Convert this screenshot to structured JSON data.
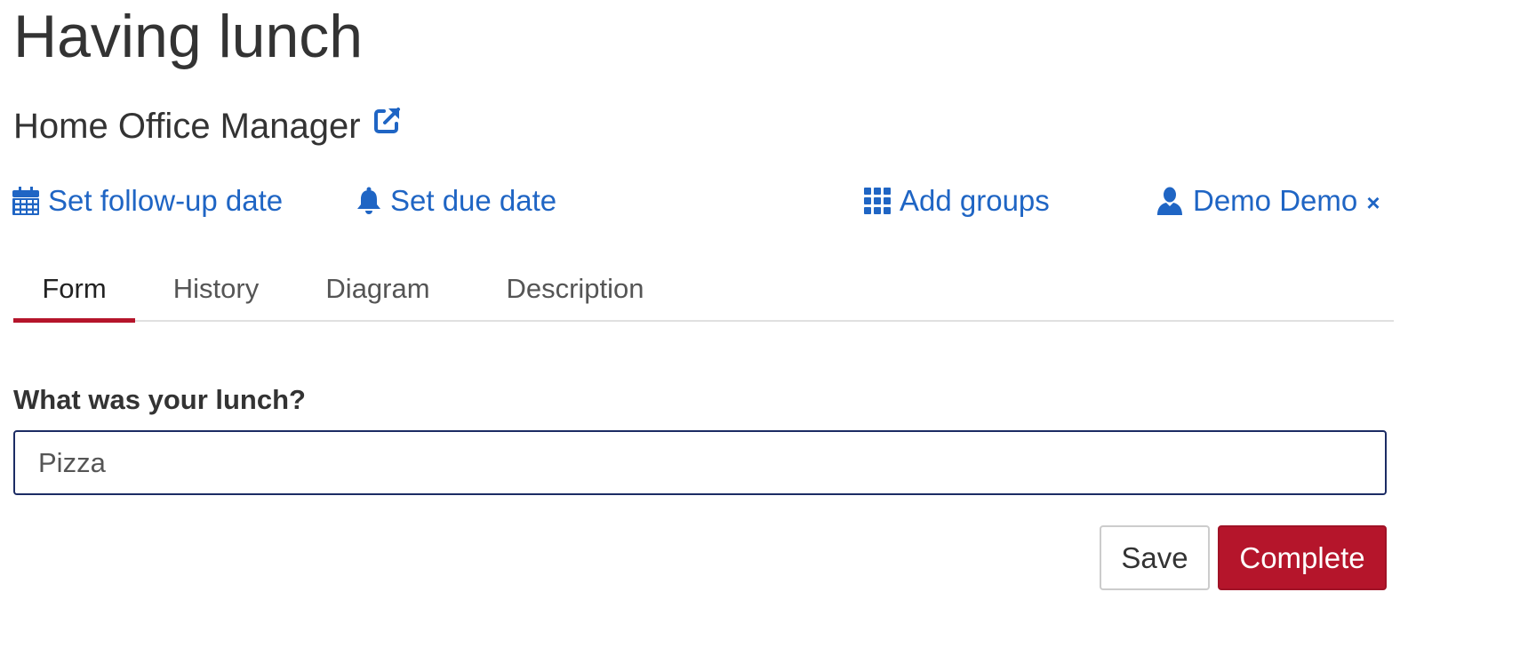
{
  "task": {
    "title": "Having lunch",
    "process_name": "Home Office Manager"
  },
  "actions": {
    "follow_up": "Set follow-up date",
    "due_date": "Set due date",
    "groups": "Add groups",
    "assignee": "Demo Demo",
    "remove_assignee": "×"
  },
  "tabs": [
    {
      "label": "Form",
      "active": true
    },
    {
      "label": "History",
      "active": false
    },
    {
      "label": "Diagram",
      "active": false
    },
    {
      "label": "Description",
      "active": false
    }
  ],
  "form": {
    "field_label": "What was your lunch?",
    "field_value": "Pizza"
  },
  "buttons": {
    "save": "Save",
    "complete": "Complete"
  },
  "colors": {
    "link": "#1f65c4",
    "accent": "#b5152b",
    "input_border": "#1c2c64"
  },
  "icons": {
    "process_link": "external-link-icon",
    "follow_up": "calendar-icon",
    "due_date": "bell-icon",
    "groups": "grid-icon",
    "assignee": "user-icon"
  }
}
